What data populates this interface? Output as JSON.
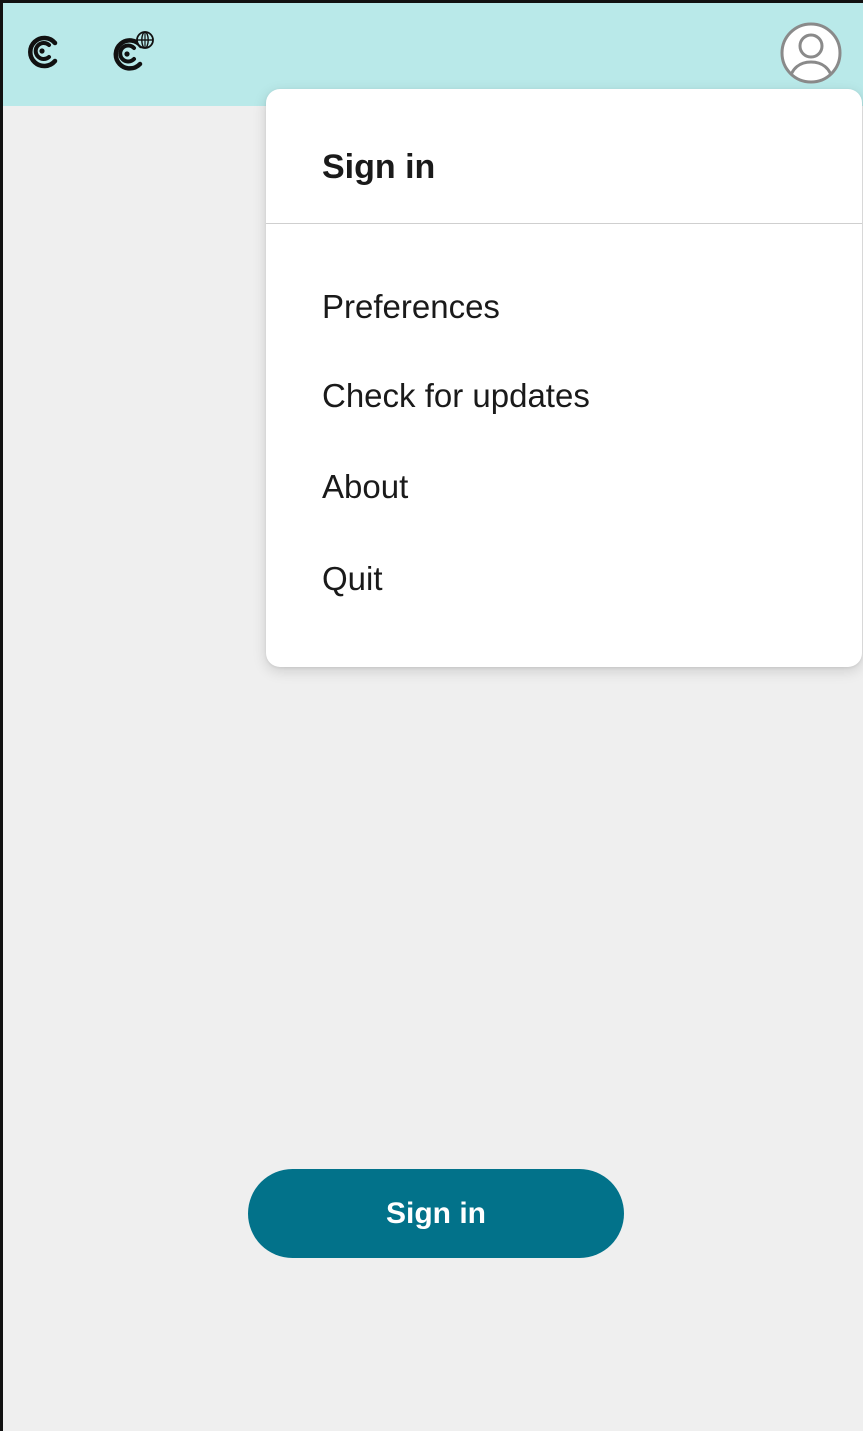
{
  "colors": {
    "topbar": "#b9e9e9",
    "background": "#efefef",
    "menu_background": "#ffffff",
    "primary_button": "#02728a",
    "text": "#1a1a1a"
  },
  "topbar": {
    "icons": [
      "app-icon",
      "app-web-icon"
    ],
    "avatar_icon": "user-avatar-icon"
  },
  "menu": {
    "title": "Sign in",
    "items": [
      "Preferences",
      "Check for updates",
      "About",
      "Quit"
    ]
  },
  "main": {
    "signin_button_label": "Sign in"
  }
}
